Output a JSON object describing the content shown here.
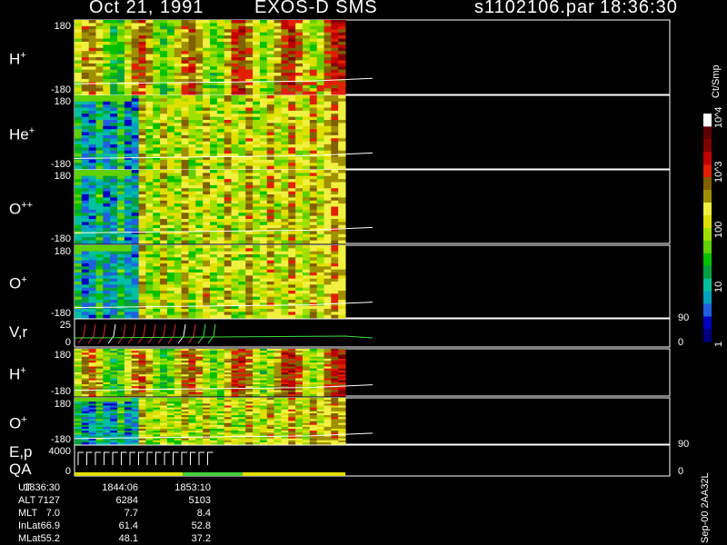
{
  "header": {
    "date": "Oct 21, 1991",
    "instrument": "EXOS-D SMS",
    "file": "s1102106.par",
    "time": "18:36:30"
  },
  "colorbar": {
    "unit": "Ct/Smp",
    "ticks": [
      {
        "label": "1",
        "value": 1
      },
      {
        "label": "10",
        "value": 10
      },
      {
        "label": "100",
        "value": 100
      },
      {
        "label": "10^3",
        "value": 1000
      },
      {
        "label": "10^4",
        "value": 10000
      }
    ],
    "colors": [
      "#000080",
      "#0000c0",
      "#2060e0",
      "#00a0c0",
      "#00c0a0",
      "#00a040",
      "#00c000",
      "#60d000",
      "#a0e000",
      "#e0e000",
      "#f0f040",
      "#a09000",
      "#806000",
      "#e02000",
      "#c00000",
      "#800000",
      "#600000",
      "#ffffff"
    ]
  },
  "chart_data": {
    "type": "heatmap",
    "time_axis": {
      "label": "UT",
      "ticks": [
        "1836:30",
        "1844:06",
        "1853:10"
      ],
      "data_coverage_fraction": 0.455
    },
    "panels": [
      {
        "id": "h-plus",
        "label": "H",
        "sup": "+",
        "ylim": [
          -180,
          180
        ],
        "ytick_top": "180",
        "ytick_bottom": "-180"
      },
      {
        "id": "he-plus",
        "label": "He",
        "sup": "+",
        "ylim": [
          -180,
          180
        ],
        "ytick_top": "180",
        "ytick_bottom": "-180"
      },
      {
        "id": "o-plusplus",
        "label": "O",
        "sup": "++",
        "ylim": [
          -180,
          180
        ],
        "ytick_top": "180",
        "ytick_bottom": "-180"
      },
      {
        "id": "o-plus",
        "label": "O",
        "sup": "+",
        "ylim": [
          -180,
          180
        ],
        "ytick_top": "180",
        "ytick_bottom": "-180"
      },
      {
        "id": "vr",
        "label": "V,r",
        "sup": "",
        "ytick_top": "25",
        "ytick_bottom": "0",
        "right_ticks": [
          "90",
          "0"
        ]
      },
      {
        "id": "h-plus-2",
        "label": "H",
        "sup": "+",
        "ylim": [
          -180,
          180
        ],
        "ytick_top": "180",
        "ytick_bottom": "-180"
      },
      {
        "id": "o-plus-2",
        "label": "O",
        "sup": "+",
        "ylim": [
          -180,
          180
        ],
        "ytick_top": "180",
        "ytick_bottom": "-180"
      },
      {
        "id": "ep-qa",
        "label": "E,p",
        "label2": "QA",
        "sup": "",
        "ytick_top": "4000",
        "ytick_bottom": "0",
        "right_ticks": [
          "90",
          "0"
        ]
      }
    ]
  },
  "ephemeris": {
    "rows": [
      {
        "label": "UT",
        "values": [
          "1836:30",
          "1844:06",
          "1853:10"
        ]
      },
      {
        "label": "ALT",
        "values": [
          "7127",
          "6284",
          "5103"
        ]
      },
      {
        "label": "MLT",
        "values": [
          "7.0",
          "7.7",
          "8.4"
        ]
      },
      {
        "label": "InLat",
        "values": [
          "66.9",
          "61.4",
          "52.8"
        ]
      },
      {
        "label": "MLat",
        "values": [
          "55.2",
          "48.1",
          "37.2"
        ]
      }
    ]
  },
  "footer": {
    "stamp": "Sep-00 2AA32L"
  }
}
